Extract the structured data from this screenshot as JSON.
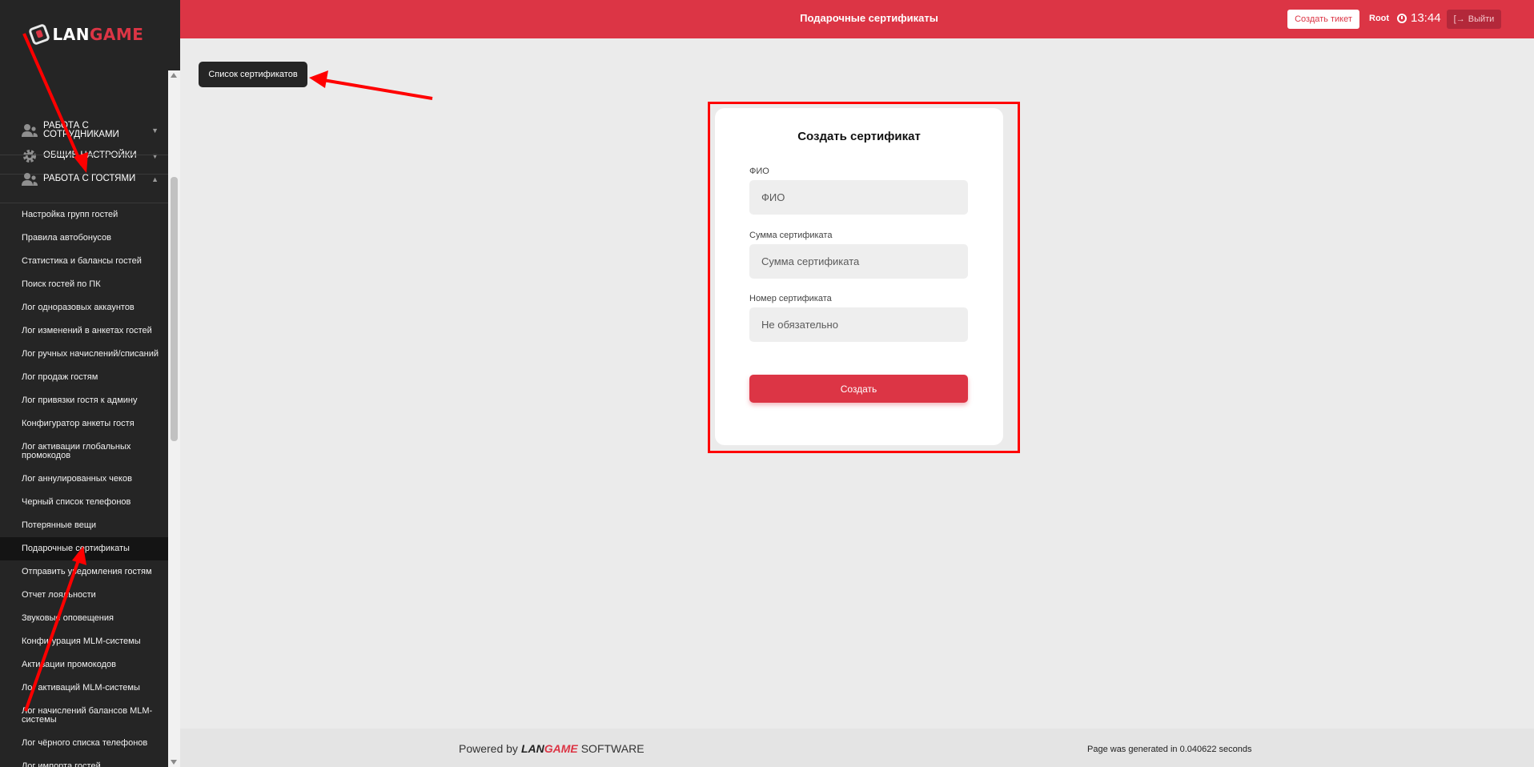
{
  "brand": {
    "part1": "LAN",
    "part2": "GAME"
  },
  "sidebar": {
    "sections": [
      {
        "label": "Общие настройки"
      },
      {
        "label": "Работа с сотрудниками"
      },
      {
        "label": "Работа с гостями"
      }
    ],
    "items": [
      {
        "label": "Настройка групп гостей"
      },
      {
        "label": "Правила автобонусов"
      },
      {
        "label": "Статистика и балансы гостей"
      },
      {
        "label": "Поиск гостей по ПК"
      },
      {
        "label": "Лог одноразовых аккаунтов"
      },
      {
        "label": "Лог изменений в анкетах гостей"
      },
      {
        "label": "Лог ручных начислений/списаний"
      },
      {
        "label": "Лог продаж гостям"
      },
      {
        "label": "Лог привязки гостя к админу"
      },
      {
        "label": "Конфигуратор анкеты гостя"
      },
      {
        "label": "Лог активации глобальных промокодов"
      },
      {
        "label": "Лог аннулированных чеков"
      },
      {
        "label": "Черный список телефонов"
      },
      {
        "label": "Потерянные вещи"
      },
      {
        "label": "Подарочные сертификаты"
      },
      {
        "label": "Отправить уведомления гостям"
      },
      {
        "label": "Отчет лояльности"
      },
      {
        "label": "Звуковые оповещения"
      },
      {
        "label": "Конфигурация MLM-системы"
      },
      {
        "label": "Активации промокодов"
      },
      {
        "label": "Лог активаций MLM-системы"
      },
      {
        "label": "Лог начислений балансов MLM-системы"
      },
      {
        "label": "Лог чёрного списка телефонов"
      },
      {
        "label": "Лог импорта гостей"
      }
    ]
  },
  "header": {
    "title": "Подарочные сертификаты",
    "create_ticket": "Создать тикет",
    "user": "Root",
    "time": "13:44",
    "logout": "Выйти"
  },
  "content": {
    "list_button": "Список сертификатов",
    "form": {
      "title": "Создать сертификат",
      "fields": [
        {
          "label": "ФИО",
          "placeholder": "ФИО"
        },
        {
          "label": "Сумма сертификата",
          "placeholder": "Сумма сертификата"
        },
        {
          "label": "Номер сертификата",
          "placeholder": "Не обязательно"
        }
      ],
      "submit": "Создать"
    }
  },
  "footer": {
    "powered_prefix": "Powered by",
    "powered_suffix": "SOFTWARE",
    "generated": "Page was generated in 0.040622 seconds"
  },
  "colors": {
    "accent": "#dc3545",
    "sidebar": "#252525",
    "annotation": "#ff0000"
  }
}
